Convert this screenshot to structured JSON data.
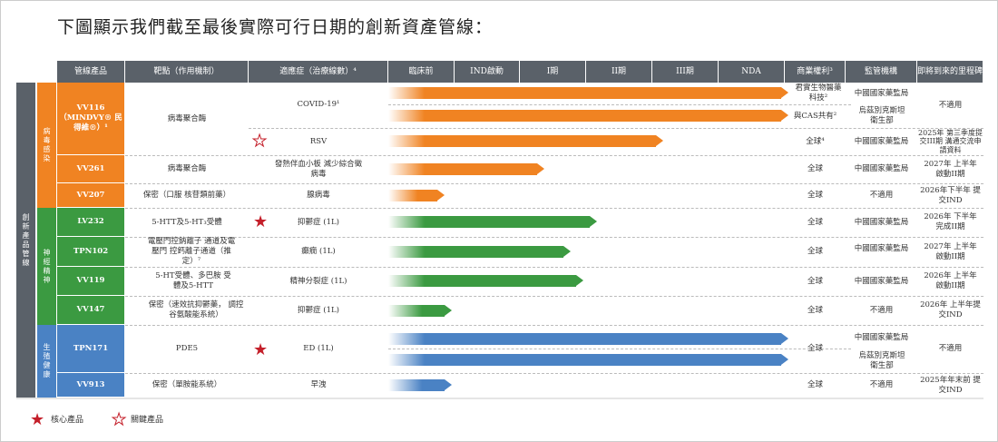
{
  "title": "下圖顯示我們截至最後實際可行日期的創新資產管線：",
  "headers": {
    "product": "管線產品",
    "target": "靶點（作用機制）",
    "indication": "適應症（治療線數）⁴",
    "phases": [
      "臨床前",
      "IND啟動",
      "I期",
      "II期",
      "III期",
      "NDA"
    ],
    "rights": "商業權利³",
    "regulator": "監管機構",
    "milestone": "即將到來的里程碑"
  },
  "groups": {
    "outer": "創新產品管線",
    "viral": "病毒感染",
    "neuro": "神經精神",
    "repro": "生殖健康"
  },
  "colors": {
    "viral": "#f08322",
    "neuro": "#3b9a41",
    "repro": "#4a82c4",
    "header": "#5a6169",
    "star": "#c41f2a"
  },
  "rows": [
    {
      "product": "VV116（MINDVY® 民得維®）¹",
      "target": "病毒聚合酶",
      "indication": "COVID-19¹",
      "rights": [
        "君實生物醫藥科技²",
        "與CAS共有²"
      ],
      "regulator": [
        "中國國家藥監局",
        "烏茲別克斯坦衛生部"
      ],
      "milestone": "不適用",
      "progress": [
        6,
        6
      ]
    },
    {
      "indication": "RSV",
      "rights": "全球⁴",
      "regulator": "中國國家藥監局",
      "milestone": "2025年 第三季度提交III期 溝通交流申請資料",
      "progress": 4.1,
      "star": "key"
    },
    {
      "product": "VV261",
      "target": "病毒聚合酶",
      "indication": "發熱伴血小板 減少綜合徵病毒",
      "rights": "全球",
      "regulator": "中國國家藥監局",
      "milestone": "2027年 上半年啟動II期",
      "progress": 2.3
    },
    {
      "product": "VV207",
      "target": "保密（口服 核苷類前藥）",
      "indication": "腺病毒",
      "rights": "全球",
      "regulator": "不適用",
      "milestone": "2026年下半年 提交IND",
      "progress": 0.8
    },
    {
      "product": "LV232",
      "target": "5-HTT及5-HT₃受體",
      "indication": "抑鬱症 (1L)",
      "rights": "全球",
      "regulator": "中國國家藥監局",
      "milestone": "2026年 下半年完成II期",
      "progress": 3.1,
      "star": "core"
    },
    {
      "product": "TPN102",
      "target": "電壓門控鈉離子 通道及電壓門 控鈣離子通道（推定）⁷",
      "indication": "癲癇 (1L)",
      "rights": "全球",
      "regulator": "中國國家藥監局",
      "milestone": "2027年 上半年啟動II期",
      "progress": 2.7
    },
    {
      "product": "VV119",
      "target": "5-HT受體、多巴胺 受體及5-HTT",
      "indication": "精神分裂症 (1L)",
      "rights": "全球",
      "regulator": "中國國家藥監局",
      "milestone": "2026年 上半年啟動II期",
      "progress": 2.9
    },
    {
      "product": "VV147",
      "target": "保密（速效抗抑鬱藥， 調控谷氨酸能系統）",
      "indication": "抑鬱症 (1L)",
      "rights": "全球",
      "regulator": "不適用",
      "milestone": "2026年 上半年提交IND",
      "progress": 0.9
    },
    {
      "product": "TPN171",
      "target": "PDE5",
      "indication": "ED (1L)",
      "rights": "全球",
      "regulator": [
        "中國國家藥監局",
        "烏茲別克斯坦衛生部"
      ],
      "milestone": "不適用",
      "progress": [
        6,
        6
      ],
      "star": "core"
    },
    {
      "product": "VV913",
      "target": "保密（單胺能系統）",
      "indication": "早洩",
      "rights": "全球",
      "regulator": "不適用",
      "milestone": "2025年年末前 提交IND",
      "progress": 0.9
    }
  ],
  "legend": {
    "core": "核心產品",
    "key": "關鍵產品"
  }
}
